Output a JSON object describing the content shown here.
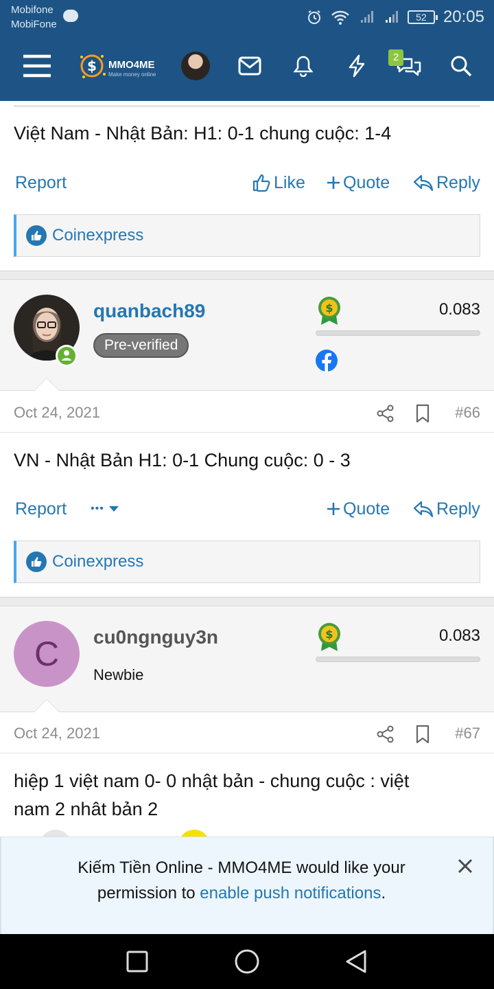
{
  "status": {
    "carrier_1": "Mobifone",
    "carrier_2": "MobiFone",
    "battery": "52",
    "time": "20:05"
  },
  "header": {
    "logo_text": "MMO4ME",
    "logo_sub": "Make money online",
    "conversations_badge": "2"
  },
  "post_65": {
    "text": "Việt Nam - Nhật Bản: H1: 0-1 chung cuộc: 1-4",
    "report": "Report",
    "like": "Like",
    "quote": "Quote",
    "reply": "Reply",
    "reaction_user": "Coinexpress"
  },
  "post_66": {
    "username": "quanbach89",
    "user_title": "Pre-verified",
    "score": "0.083",
    "date": "Oct 24, 2021",
    "number": "#66",
    "text": "VN - Nhật Bản H1: 0-1 Chung cuộc: 0 - 3",
    "report": "Report",
    "more": "•••",
    "quote": "Quote",
    "reply": "Reply",
    "reaction_user": "Coinexpress"
  },
  "post_67": {
    "avatar_letter": "C",
    "username": "cu0ngnguy3n",
    "user_title": "Newbie",
    "score": "0.083",
    "date": "Oct 24, 2021",
    "number": "#67",
    "text_line1": "hiệp 1 việt nam 0- 0 nhật bản - chung cuộc : việt",
    "text_line2": "nam 2 nhật bản 2"
  },
  "notification": {
    "text_before": "Kiếm Tiền Online - MMO4ME would like your permission to ",
    "link": "enable push notifications",
    "text_after": "."
  },
  "colors": {
    "header_bg": "#1d5485",
    "link": "#2577b1",
    "badge": "#8cc63f"
  }
}
